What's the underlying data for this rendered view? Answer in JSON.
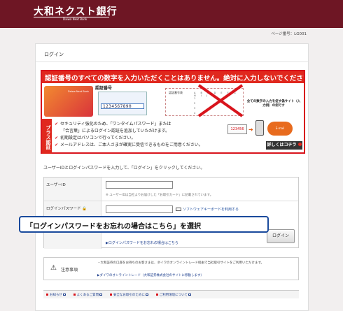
{
  "header": {
    "logo": "大和ネクスト銀行",
    "logo_sub": "Daiwa Next Bank"
  },
  "page_number": "ページ番号：LG001",
  "card_title": "ログイン",
  "banner": {
    "headline": "認証番号のすべての数字を入力いただくことはありません。絶対に入力しないでください。",
    "otp_label": "認証番号",
    "otp_value": "1234567890",
    "card_brand": "Daiwa Next Bank",
    "grid_label": "認証番号表",
    "grid_cols": "A B C D E F G H I J",
    "grid_rows": [
      "1",
      "2",
      "3",
      "4"
    ],
    "right_note": "全ての数字の入力を促す偽サイト（入力例）の例です",
    "plus_tag": "プラス認証",
    "bullets": [
      "セキュリティ強化のため、「ワンタイムパスワード」または",
      "「合言葉」によるログイン認証を追加していただけます。",
      "初期設定はパソコンで行ってください。",
      "メールアドレスは、ご本人さまが確実に受信できるものをご用意ください。"
    ],
    "mini_otp": "123456",
    "mini_mail": "E-mail",
    "details_button": "詳しくはコチラ"
  },
  "instruction": "ユーザーIDとログインパスワードを入力して、「ログイン」をクリックしてください。",
  "form": {
    "userid_label": "ユーザーID",
    "userid_value": "",
    "userid_note": "※ ユーザーIDは当社よりお届けした「お取引カード」に記載されています。",
    "password_label": "ログインパスワード",
    "password_value": "",
    "software_keyboard": "ソフトウェアキーボードを利用する",
    "login_button": "ログイン",
    "forgot_link": "▶ログインパスワードをお忘れの場合はこちら"
  },
  "callout": "「ログインパスワードをお忘れの場合はこちら」を選択",
  "caution": {
    "title": "注意事項",
    "text": "・大和証券の口座をお持ちのお客さまは、ダイワのオンライントレード経由で当社取引サイトをご利用いただけます。",
    "link": "▶ダイワのオンライントレード（大和証券株式会社のサイトに移動します）"
  },
  "footer": [
    "お知らせ",
    "よくあるご質問",
    "安全なお取引のために",
    "ご利用環境について"
  ]
}
